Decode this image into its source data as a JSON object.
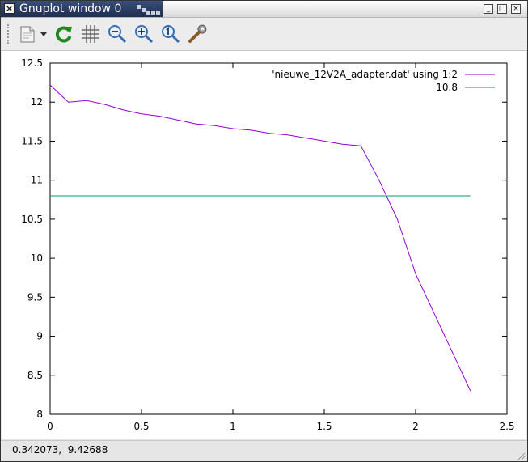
{
  "window": {
    "title": "Gnuplot window 0",
    "close_glyph": "×",
    "minimize_glyph": "_",
    "maximize_glyph": "□",
    "close_btn_glyph": "×"
  },
  "toolbar": {
    "buttons": [
      {
        "name": "copy-to-clipboard-icon"
      },
      {
        "name": "dropdown-arrow-icon"
      },
      {
        "name": "replot-icon"
      },
      {
        "name": "grid-icon"
      },
      {
        "name": "zoom-back-icon"
      },
      {
        "name": "zoom-forward-icon"
      },
      {
        "name": "autoscale-icon"
      },
      {
        "name": "settings-icon"
      }
    ]
  },
  "status": {
    "text": "0.342073,  9.42688"
  },
  "chart_data": {
    "type": "line",
    "xlim": [
      0,
      2.5
    ],
    "ylim": [
      8,
      12.5
    ],
    "x_ticks": [
      "0",
      "0.5",
      "1",
      "1.5",
      "2",
      "2.5"
    ],
    "y_ticks": [
      "8",
      "8.5",
      "9",
      "9.5",
      "10",
      "10.5",
      "11",
      "11.5",
      "12",
      "12.5"
    ],
    "grid": false,
    "legend_position": "top-right",
    "series": [
      {
        "name": "'nieuwe_12V2A_adapter.dat' using 1:2",
        "color": "#9400d3",
        "x": [
          0,
          0.1,
          0.2,
          0.3,
          0.4,
          0.5,
          0.6,
          0.7,
          0.8,
          0.9,
          1.0,
          1.1,
          1.2,
          1.3,
          1.4,
          1.5,
          1.6,
          1.7,
          1.8,
          1.9,
          2.0,
          2.1,
          2.2,
          2.3
        ],
        "y": [
          12.22,
          12.0,
          12.02,
          11.97,
          11.9,
          11.85,
          11.82,
          11.77,
          11.72,
          11.7,
          11.66,
          11.64,
          11.6,
          11.58,
          11.54,
          11.5,
          11.46,
          11.44,
          11.0,
          10.5,
          9.8,
          9.3,
          8.8,
          8.3
        ]
      },
      {
        "name": "10.8",
        "color": "#009e73",
        "x": [
          0,
          2.3
        ],
        "y": [
          10.8,
          10.8
        ]
      }
    ]
  }
}
